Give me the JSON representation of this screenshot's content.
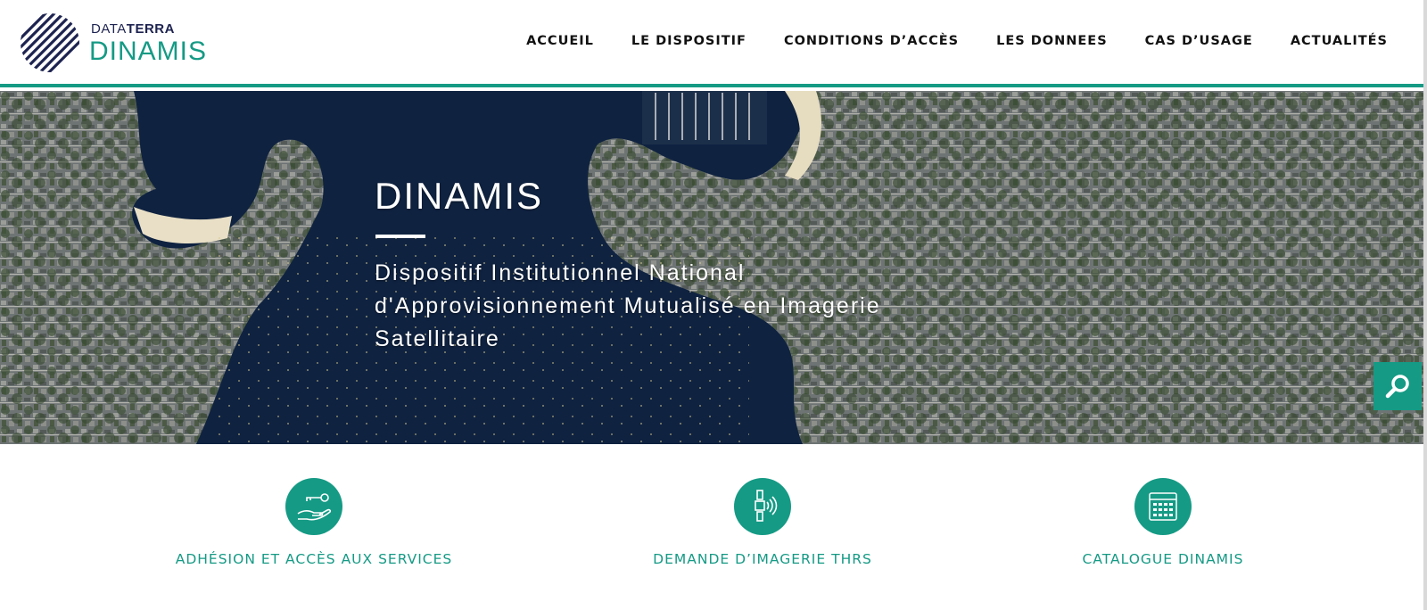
{
  "brand": {
    "top_plain": "DATA",
    "top_bold": "TERRA",
    "main": "DINAMIS"
  },
  "nav": [
    {
      "label": "ACCUEIL"
    },
    {
      "label": "LE DISPOSITIF"
    },
    {
      "label": "CONDITIONS D’ACCÈS"
    },
    {
      "label": "LES DONNEES"
    },
    {
      "label": "CAS D’USAGE"
    },
    {
      "label": "ACTUALITÉS"
    }
  ],
  "hero": {
    "title": "DINAMIS",
    "subtitle": "Dispositif Institutionnel National d'Approvisionnement Mutualisé en Imagerie Satellitaire"
  },
  "services": [
    {
      "label": "ADHÉSION ET ACCÈS AUX SERVICES",
      "icon": "hand-key-icon"
    },
    {
      "label": "DEMANDE D’IMAGERIE THRS",
      "icon": "satellite-icon"
    },
    {
      "label": "CATALOGUE DINAMIS",
      "icon": "catalogue-grid-icon"
    }
  ],
  "colors": {
    "accent": "#159a85",
    "brand_dark": "#1d2350",
    "sea": "#0f2240"
  }
}
